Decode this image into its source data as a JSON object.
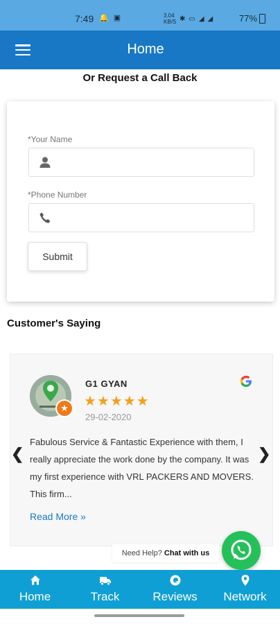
{
  "statusbar": {
    "time": "7:49",
    "network_speed": "3.04 KB/S",
    "battery": "77%"
  },
  "appbar": {
    "title": "Home"
  },
  "callback": {
    "heading": "Or Request a Call Back",
    "name_label": "*Your Name",
    "name_value": "",
    "phone_label": "*Phone Number",
    "phone_value": "",
    "submit_label": "Submit"
  },
  "customers": {
    "heading": "Customer's Saying",
    "review": {
      "name": "G1 GYAN",
      "stars": "★★★★★",
      "rating": 5,
      "date": "29-02-2020",
      "text": "Fabulous Service & Fantastic Experience with them, I really appreciate the work done by the company. It was my first experience with VRL PACKERS AND MOVERS. This firm...",
      "read_more": "Read More »"
    }
  },
  "help": {
    "prefix": "Need Help?",
    "link": "Chat with us"
  },
  "nav": {
    "items": [
      {
        "label": "Home",
        "icon": "home-icon"
      },
      {
        "label": "Track",
        "icon": "truck-icon"
      },
      {
        "label": "Reviews",
        "icon": "reviews-icon"
      },
      {
        "label": "Network",
        "icon": "location-pin-icon"
      }
    ]
  },
  "colors": {
    "appbar": "#1878c6",
    "statusbar": "#5aa9e3",
    "bottomnav": "#0f9fd4",
    "stars": "#f2a01c",
    "whatsapp": "#25c05a"
  }
}
